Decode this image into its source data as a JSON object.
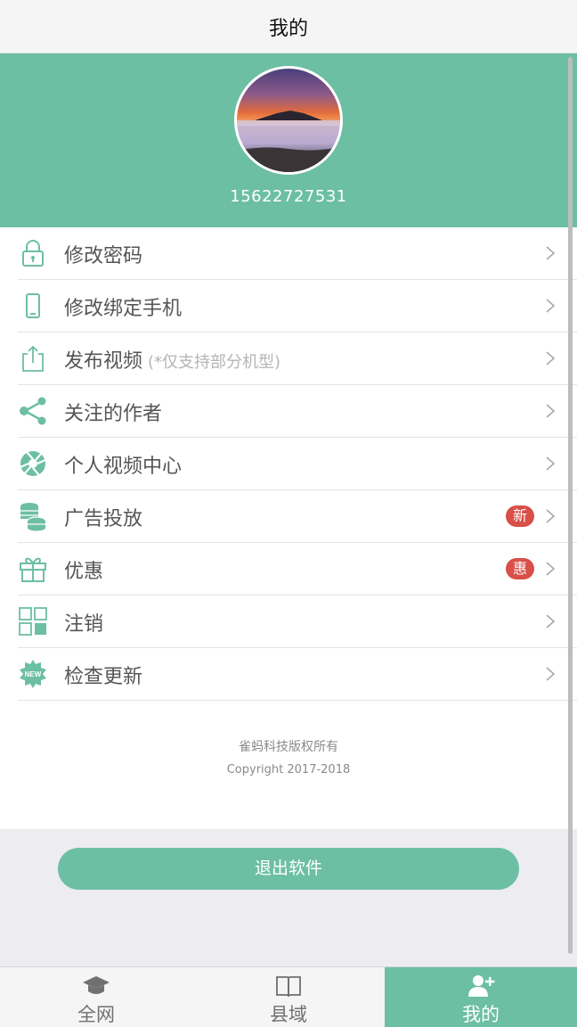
{
  "header": {
    "title": "我的"
  },
  "profile": {
    "phone": "15622727531"
  },
  "menu": [
    {
      "label": "修改密码",
      "icon": "lock-icon"
    },
    {
      "label": "修改绑定手机",
      "icon": "phone-icon"
    },
    {
      "label": "发布视频",
      "note": "(*仅支持部分机型)",
      "icon": "upload-icon"
    },
    {
      "label": "关注的作者",
      "icon": "share-icon"
    },
    {
      "label": "个人视频中心",
      "icon": "aperture-icon"
    },
    {
      "label": "广告投放",
      "badge": "新",
      "icon": "coins-icon"
    },
    {
      "label": "优惠",
      "badge": "惠",
      "icon": "gift-icon"
    },
    {
      "label": "注销",
      "icon": "grid-icon"
    },
    {
      "label": "检查更新",
      "icon": "new-badge-icon",
      "icon_text": "NEW"
    }
  ],
  "footer": {
    "company": "雀蚂科技版权所有",
    "copyright": "Copyright 2017-2018"
  },
  "logout": {
    "label": "退出软件"
  },
  "tabs": [
    {
      "label": "全网",
      "icon": "graduation-cap-icon",
      "active": false
    },
    {
      "label": "县域",
      "icon": "book-icon",
      "active": false
    },
    {
      "label": "我的",
      "icon": "add-user-icon",
      "active": true
    }
  ],
  "colors": {
    "accent": "#6cbfa3",
    "badge": "#d85048"
  }
}
